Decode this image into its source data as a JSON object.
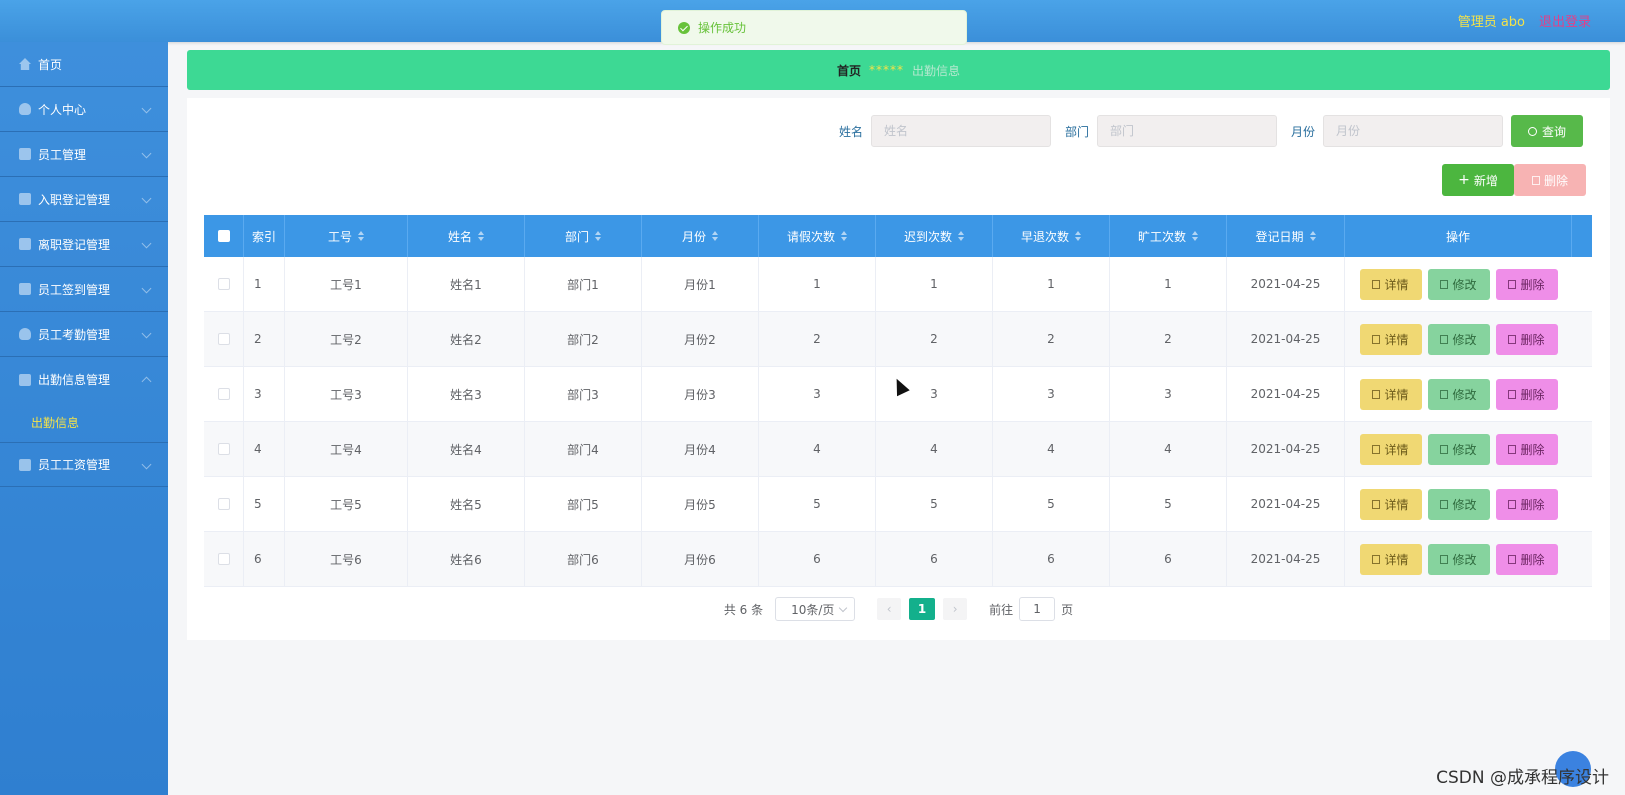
{
  "topbar": {
    "admin_label": "管理员 abo",
    "logout_label": "退出登录"
  },
  "toast": {
    "message": "操作成功"
  },
  "sidebar": {
    "items": [
      {
        "label": "首页",
        "icon": "home-icon",
        "expandable": false
      },
      {
        "label": "个人中心",
        "icon": "user-icon",
        "expandable": true
      },
      {
        "label": "员工管理",
        "icon": "staff-icon",
        "expandable": true
      },
      {
        "label": "入职登记管理",
        "icon": "document-icon",
        "expandable": true
      },
      {
        "label": "离职登记管理",
        "icon": "briefcase-icon",
        "expandable": true
      },
      {
        "label": "员工签到管理",
        "icon": "checkin-icon",
        "expandable": true
      },
      {
        "label": "员工考勤管理",
        "icon": "clock-icon",
        "expandable": true
      },
      {
        "label": "出勤信息管理",
        "icon": "attendance-icon",
        "expandable": true,
        "expanded": true
      }
    ],
    "submenu_label": "出勤信息",
    "last_item": {
      "label": "员工工资管理",
      "icon": "salary-icon"
    }
  },
  "breadcrumb": {
    "home": "首页",
    "separator": "*****",
    "current": "出勤信息"
  },
  "search": {
    "name_label": "姓名",
    "name_placeholder": "姓名",
    "dept_label": "部门",
    "dept_placeholder": "部门",
    "month_label": "月份",
    "month_placeholder": "月份",
    "query_label": "查询"
  },
  "actions": {
    "add_label": "新增",
    "delete_label": "删除"
  },
  "table": {
    "headers": [
      "索引",
      "工号",
      "姓名",
      "部门",
      "月份",
      "请假次数",
      "迟到次数",
      "早退次数",
      "旷工次数",
      "登记日期",
      "操作"
    ],
    "rows": [
      [
        "1",
        "工号1",
        "姓名1",
        "部门1",
        "月份1",
        "1",
        "1",
        "1",
        "1",
        "2021-04-25"
      ],
      [
        "2",
        "工号2",
        "姓名2",
        "部门2",
        "月份2",
        "2",
        "2",
        "2",
        "2",
        "2021-04-25"
      ],
      [
        "3",
        "工号3",
        "姓名3",
        "部门3",
        "月份3",
        "3",
        "3",
        "3",
        "3",
        "2021-04-25"
      ],
      [
        "4",
        "工号4",
        "姓名4",
        "部门4",
        "月份4",
        "4",
        "4",
        "4",
        "4",
        "2021-04-25"
      ],
      [
        "5",
        "工号5",
        "姓名5",
        "部门5",
        "月份5",
        "5",
        "5",
        "5",
        "5",
        "2021-04-25"
      ],
      [
        "6",
        "工号6",
        "姓名6",
        "部门6",
        "月份6",
        "6",
        "6",
        "6",
        "6",
        "2021-04-25"
      ]
    ],
    "row_actions": {
      "detail": "详情",
      "edit": "修改",
      "delete": "删除"
    }
  },
  "pagination": {
    "total_text": "共 6 条",
    "page_size": "10条/页",
    "current_page": "1",
    "goto_label": "前往",
    "goto_value": "1",
    "page_suffix": "页"
  },
  "watermark": "CSDN @成承程序设计"
}
